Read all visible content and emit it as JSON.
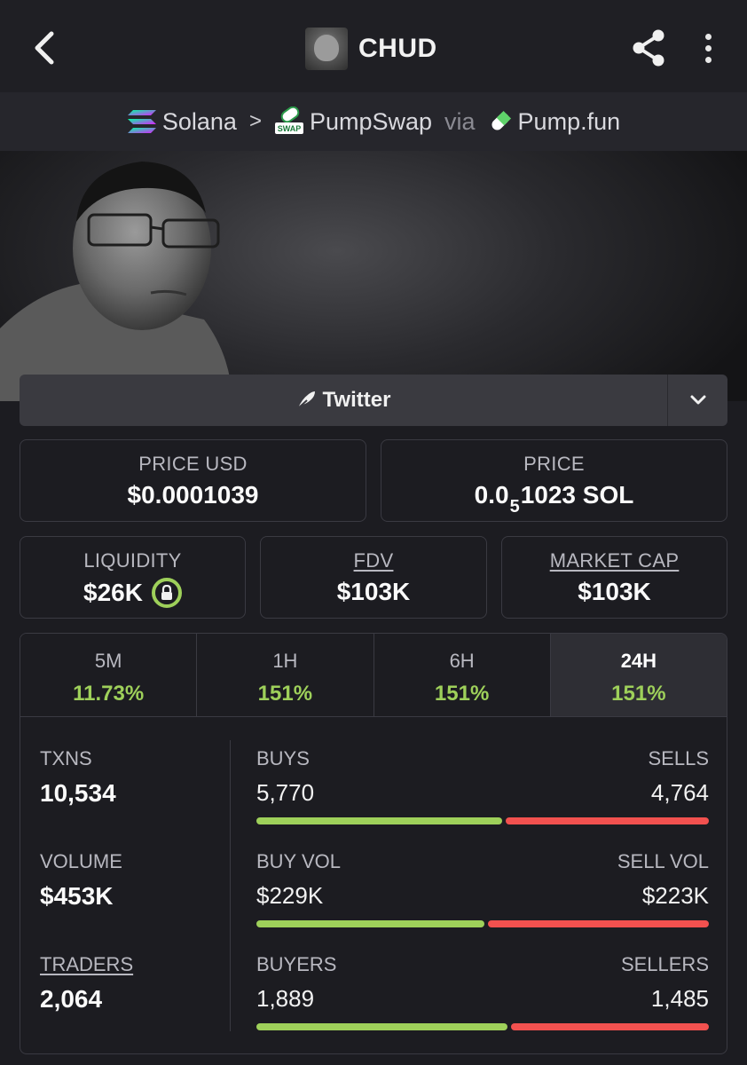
{
  "header": {
    "token_name": "CHUD"
  },
  "breadcrumb": {
    "chain": "Solana",
    "separator": ">",
    "dex": "PumpSwap",
    "via": "via",
    "launchpad": "Pump.fun",
    "dex_badge": "SWAP"
  },
  "social": {
    "twitter_label": "Twitter"
  },
  "price": {
    "usd_label": "PRICE USD",
    "usd_value": "$0.0001039",
    "sol_label": "PRICE",
    "sol_prefix": "0.0",
    "sol_zeros": "5",
    "sol_suffix": "1023 SOL"
  },
  "metrics": {
    "liquidity_label": "LIQUIDITY",
    "liquidity_value": "$26K",
    "fdv_label": "FDV",
    "fdv_value": "$103K",
    "mcap_label": "MARKET CAP",
    "mcap_value": "$103K"
  },
  "timeframes": [
    {
      "label": "5M",
      "change": "11.73%"
    },
    {
      "label": "1H",
      "change": "151%"
    },
    {
      "label": "6H",
      "change": "151%"
    },
    {
      "label": "24H",
      "change": "151%"
    }
  ],
  "active_timeframe": "24H",
  "stats": {
    "txns_label": "TXNS",
    "txns_value": "10,534",
    "volume_label": "VOLUME",
    "volume_value": "$453K",
    "traders_label": "TRADERS",
    "traders_value": "2,064",
    "buys_label": "BUYS",
    "buys_value": "5,770",
    "sells_label": "SELLS",
    "sells_value": "4,764",
    "buy_share": 0.548,
    "buyvol_label": "BUY VOL",
    "buyvol_value": "$229K",
    "sellvol_label": "SELL VOL",
    "sellvol_value": "$223K",
    "buyvol_share": 0.507,
    "buyers_label": "BUYERS",
    "buyers_value": "1,889",
    "sellers_label": "SELLERS",
    "sellers_value": "1,485",
    "buyers_share": 0.56
  },
  "colors": {
    "positive": "#9ed05a",
    "negative": "#f2514f",
    "background": "#1c1c21"
  }
}
